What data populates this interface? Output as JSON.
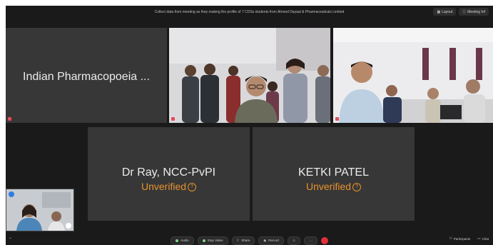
{
  "topbar": {
    "message": "Collect data from meeting as they making the profile of 7 CDSs students from Ahmed Dayaal & Pharmaceuticals Limited",
    "view_label": "Layout",
    "meeting_label": "Meeting Inf"
  },
  "tiles": [
    {
      "name": "Indian Pharmacopoeia ..."
    },
    {
      "name": "Dr Ray, NCC-PvPI",
      "status": "Unverified"
    },
    {
      "name": "KETKI PATEL",
      "status": "Unverified"
    }
  ],
  "toolbar": {
    "audio_label": "Audio",
    "video_label": "Stop Video",
    "share_label": "Share",
    "record_label": "Record",
    "participants_label": "Participants",
    "chat_label": "Chat"
  },
  "colors": {
    "background": "#1a1a1a",
    "tile": "#373737",
    "unverified": "#e8912d",
    "end": "#e0303a"
  }
}
